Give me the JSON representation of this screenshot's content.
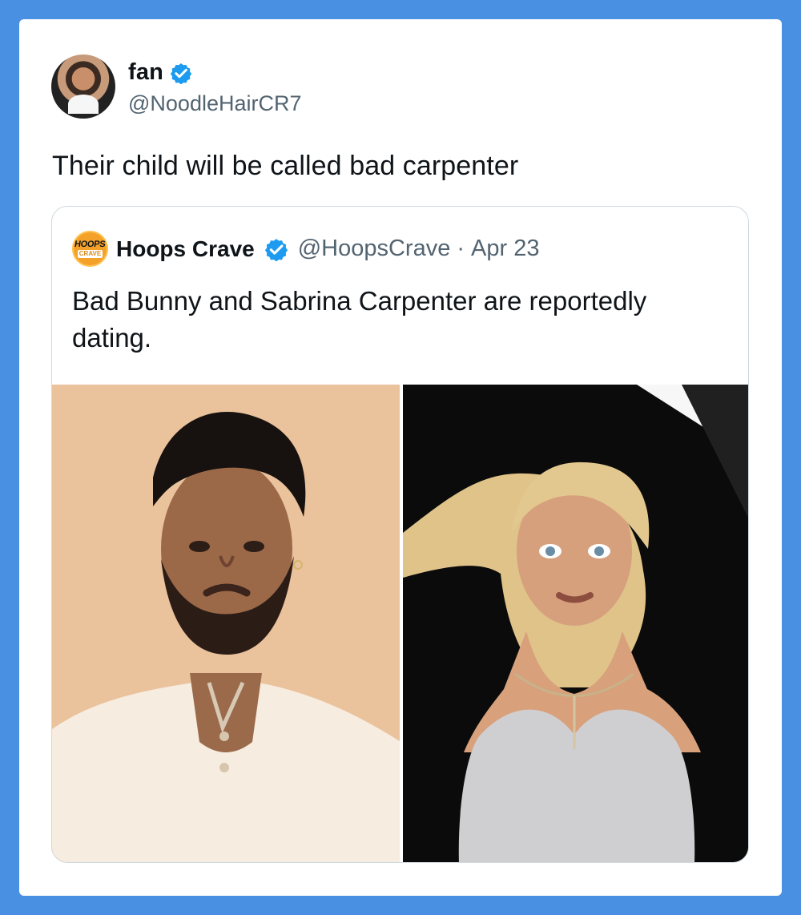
{
  "author": {
    "display_name": "fan",
    "handle": "@NoodleHairCR7",
    "avatar_icon": "portrait-avatar-icon",
    "verified_icon": "verified-badge-icon"
  },
  "tweet": {
    "text": "Their child will be called bad carpenter"
  },
  "quoted_tweet": {
    "display_name": "Hoops Crave",
    "handle": "@HoopsCrave",
    "date": "Apr 23",
    "separator": "·",
    "text": "Bad Bunny and Sabrina Carpenter are reportedly dating.",
    "avatar_logo_top": "HOOPS",
    "avatar_logo_bottom": "CRAVE",
    "media": [
      {
        "icon": "man-portrait-photo"
      },
      {
        "icon": "woman-portrait-photo"
      }
    ]
  },
  "colors": {
    "background": "#4a90e2",
    "card": "#ffffff",
    "text_primary": "#0f1419",
    "text_secondary": "#536471",
    "verified_blue": "#1d9bf0",
    "logo_orange": "#f4a12a"
  }
}
